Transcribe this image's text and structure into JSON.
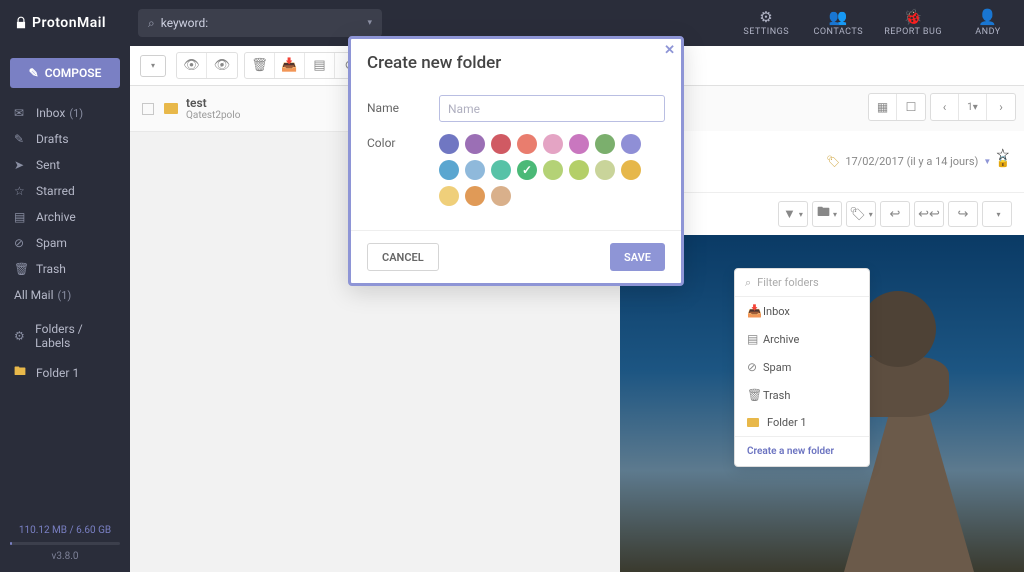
{
  "brand": "ProtonMail",
  "search": {
    "prefix": "keyword:"
  },
  "topTools": [
    {
      "label": "SETTINGS",
      "icon": "⚙"
    },
    {
      "label": "CONTACTS",
      "icon": "👥"
    },
    {
      "label": "REPORT BUG",
      "icon": "🐞"
    },
    {
      "label": "ANDY",
      "icon": "👤"
    }
  ],
  "compose": "COMPOSE",
  "nav": {
    "items": [
      {
        "label": "Inbox",
        "count": "(1)",
        "icon": "✉"
      },
      {
        "label": "Drafts",
        "icon": "✎"
      },
      {
        "label": "Sent",
        "icon": "➤"
      },
      {
        "label": "Starred",
        "icon": "☆"
      },
      {
        "label": "Archive",
        "icon": "▤"
      },
      {
        "label": "Spam",
        "icon": "⊘"
      },
      {
        "label": "Trash",
        "icon": "🗑"
      }
    ],
    "allMail": {
      "label": "All Mail",
      "count": "(1)"
    },
    "foldersHeader": "Folders / Labels",
    "folders": [
      {
        "label": "Folder 1"
      }
    ]
  },
  "foot": {
    "storage": "110.12 MB / 6.60 GB",
    "version": "v3.8.0"
  },
  "msg": {
    "title": "test",
    "sender": "Qatest2polo"
  },
  "rightPage": "1",
  "preview": {
    "date": "17/02/2017 (il y a 14 jours)",
    "dropdown": {
      "filter_placeholder": "Filter folders",
      "items": [
        "Inbox",
        "Archive",
        "Spam",
        "Trash",
        "Folder 1"
      ],
      "create": "Create a new folder"
    }
  },
  "modal": {
    "title": "Create new folder",
    "name_label": "Name",
    "name_placeholder": "Name",
    "color_label": "Color",
    "colors": [
      "#7077c2",
      "#9b6fb5",
      "#d05a63",
      "#e97d6e",
      "#e4a4c4",
      "#c977bf",
      "#7baf6d",
      "#8f8fd6",
      "#5aa6d0",
      "#8fb9db",
      "#57c2a7",
      "#4bb977",
      "#b4d276",
      "#b4cf68",
      "#c9d49a",
      "#e6b74a",
      "#efcf7a",
      "#e09a57",
      "#d9b08b"
    ],
    "selected_index": 11,
    "cancel": "CANCEL",
    "save": "SAVE"
  }
}
